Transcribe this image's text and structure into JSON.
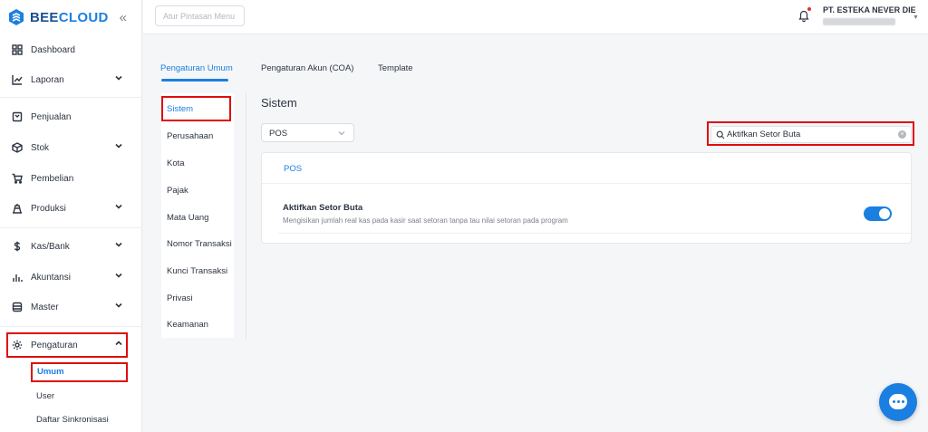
{
  "brand": {
    "name_part1": "BEE",
    "name_part2": "CLOUD"
  },
  "sidebar": {
    "items": [
      {
        "label": "Dashboard"
      },
      {
        "label": "Laporan"
      },
      {
        "label": "Penjualan"
      },
      {
        "label": "Stok"
      },
      {
        "label": "Pembelian"
      },
      {
        "label": "Produksi"
      },
      {
        "label": "Kas/Bank"
      },
      {
        "label": "Akuntansi"
      },
      {
        "label": "Master"
      },
      {
        "label": "Pengaturan"
      }
    ],
    "submenu": [
      {
        "label": "Umum"
      },
      {
        "label": "User"
      },
      {
        "label": "Daftar Sinkronisasi"
      }
    ]
  },
  "topbar": {
    "shortcut_placeholder": "Atur Pintasan Menu",
    "company": "PT. ESTEKA NEVER DIE"
  },
  "tabs": [
    {
      "label": "Pengaturan Umum"
    },
    {
      "label": "Pengaturan Akun (COA)"
    },
    {
      "label": "Template"
    }
  ],
  "settings_nav": [
    {
      "label": "Sistem"
    },
    {
      "label": "Perusahaan"
    },
    {
      "label": "Kota"
    },
    {
      "label": "Pajak"
    },
    {
      "label": "Mata Uang"
    },
    {
      "label": "Nomor Transaksi"
    },
    {
      "label": "Kunci Transaksi"
    },
    {
      "label": "Privasi"
    },
    {
      "label": "Keamanan"
    }
  ],
  "content": {
    "title": "Sistem",
    "filter_select": "POS",
    "search_value": "Aktifkan Setor Buta",
    "card_header": "POS",
    "setting": {
      "title": "Aktifkan Setor Buta",
      "description": "Mengisikan jumlah real kas pada kasir saat setoran tanpa tau nilai setoran pada program",
      "enabled": true
    }
  },
  "colors": {
    "accent": "#1a7fe0",
    "highlight_box": "#e00d0d"
  }
}
